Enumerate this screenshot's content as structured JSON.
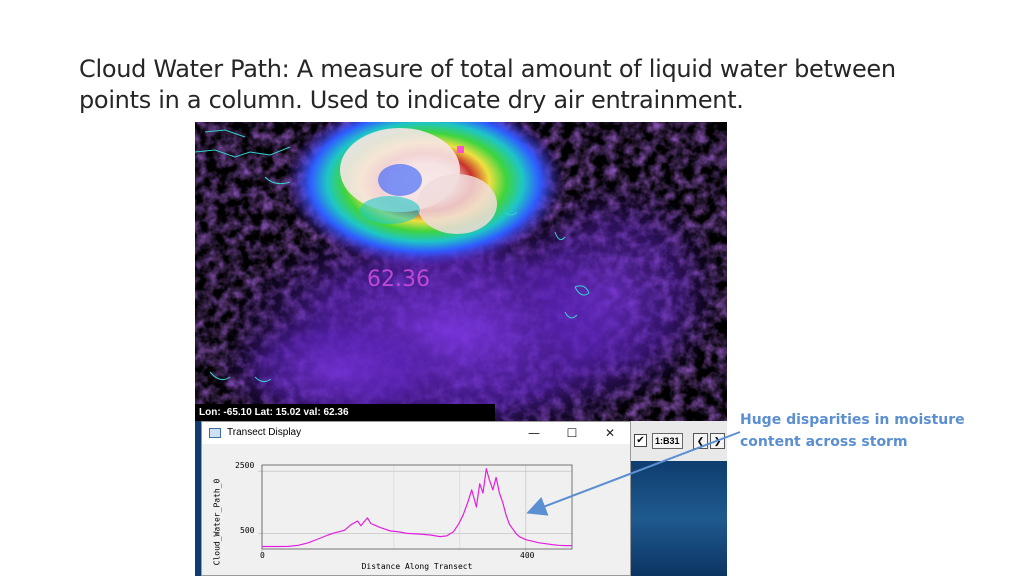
{
  "slide": {
    "title": "Cloud Water Path: A measure of total amount of liquid water between points in a column. Used to indicate dry air entrainment.",
    "annotation": "Huge disparities in moisture content across storm"
  },
  "map": {
    "overlay_value": "62.36",
    "readout": "Lon: -65.10 Lat: 15.02 val: 62.36"
  },
  "toolbar": {
    "checkbox_mark": "✔",
    "frame_label": "1:B31",
    "prev_glyph": "❮",
    "next_glyph": "❯"
  },
  "transect_window": {
    "title": "Transect Display",
    "minimize_glyph": "—",
    "maximize_glyph": "☐",
    "close_glyph": "✕"
  },
  "chart_data": {
    "type": "line",
    "title": "",
    "xlabel": "Distance Along Transect",
    "ylabel": "Cloud_Water_Path_0",
    "xlim": [
      0,
      470
    ],
    "ylim": [
      0,
      2700
    ],
    "x_ticks": [
      "0",
      "400"
    ],
    "y_ticks": [
      "2500",
      "500"
    ],
    "grid": true,
    "line_color": "#e020e0",
    "series": [
      {
        "x": [
          0,
          20,
          40,
          55,
          70,
          85,
          100,
          110,
          118,
          125,
          135,
          145,
          150,
          155,
          160,
          165,
          172,
          178,
          185,
          195,
          205,
          220,
          240,
          255,
          270,
          280,
          290,
          298,
          305,
          312,
          318,
          325,
          330,
          335,
          340,
          345,
          350,
          355,
          360,
          365,
          370,
          375,
          380,
          385,
          390,
          395,
          400,
          410,
          420,
          430,
          440,
          450,
          460,
          470
        ],
        "y": [
          80,
          80,
          85,
          120,
          200,
          320,
          450,
          520,
          560,
          600,
          780,
          900,
          750,
          880,
          1000,
          820,
          760,
          700,
          650,
          580,
          560,
          500,
          480,
          450,
          400,
          420,
          550,
          800,
          1100,
          1500,
          1900,
          1350,
          2100,
          1800,
          2580,
          2200,
          1900,
          2300,
          1800,
          1500,
          1100,
          800,
          650,
          500,
          400,
          350,
          300,
          250,
          200,
          170,
          140,
          120,
          110,
          110
        ]
      }
    ]
  }
}
